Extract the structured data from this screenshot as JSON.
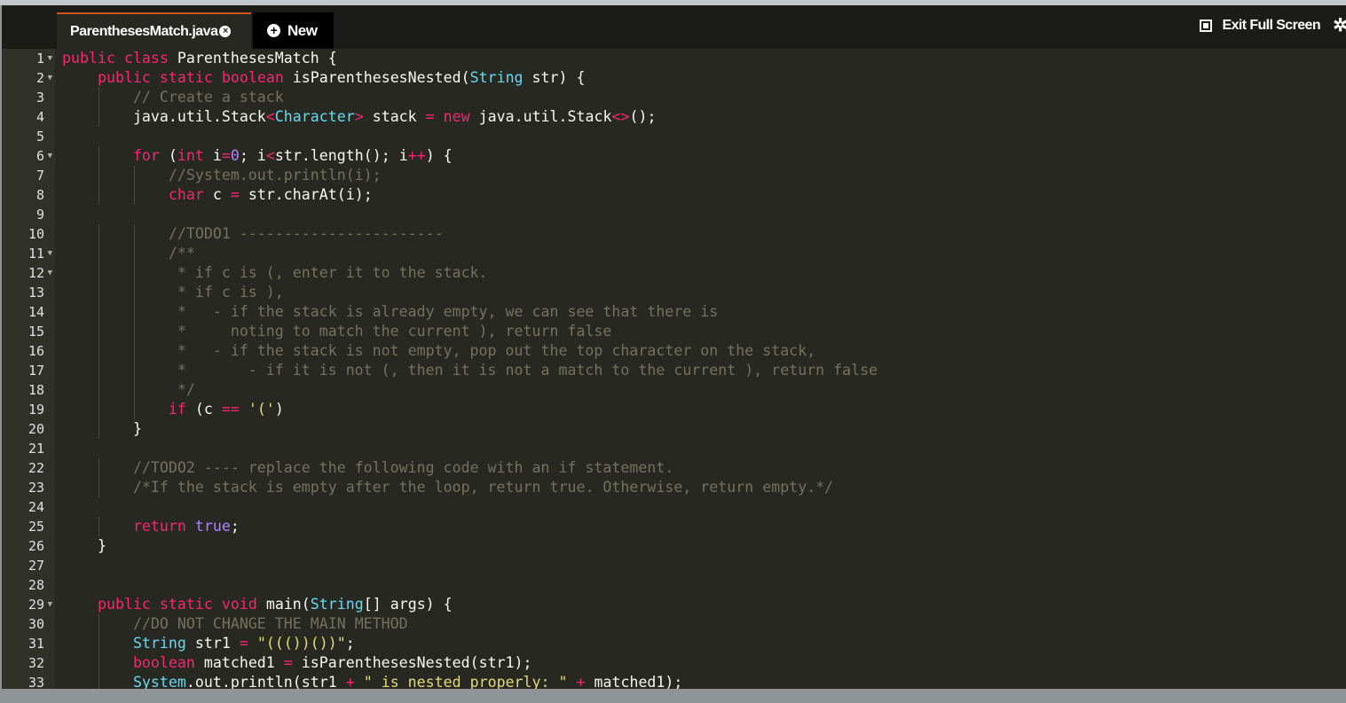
{
  "tabs": {
    "active_label": "ParenthesesMatch.java",
    "new_label": "New"
  },
  "toolbar": {
    "fullscreen_label": "Exit Full Screen"
  },
  "icons": {
    "tab_close": "close-icon",
    "new": "plus-circle-icon",
    "fullscreen": "exit-fullscreen-icon",
    "settings": "gear-icon"
  },
  "colors": {
    "editor_bg": "#272822",
    "gutter_bg": "#2f3129",
    "keyword": "#f92672",
    "type": "#66d9ef",
    "comment": "#75715e",
    "number": "#ae81ff",
    "string": "#e6db74",
    "tab_accent": "#d0541b"
  },
  "editor": {
    "lines": [
      {
        "n": "1",
        "fold": true,
        "indent": 0,
        "tokens": [
          [
            "kw",
            "public"
          ],
          [
            "pl",
            " "
          ],
          [
            "kw",
            "class"
          ],
          [
            "pl",
            " ParenthesesMatch {"
          ]
        ]
      },
      {
        "n": "2",
        "fold": true,
        "indent": 1,
        "tokens": [
          [
            "kw",
            "public"
          ],
          [
            "pl",
            " "
          ],
          [
            "kw",
            "static"
          ],
          [
            "pl",
            " "
          ],
          [
            "kw",
            "boolean"
          ],
          [
            "pl",
            " isParenthesesNested("
          ],
          [
            "ty",
            "String"
          ],
          [
            "pl",
            " str) {"
          ]
        ]
      },
      {
        "n": "3",
        "fold": false,
        "indent": 2,
        "tokens": [
          [
            "cm",
            "// Create a stack"
          ]
        ]
      },
      {
        "n": "4",
        "fold": false,
        "indent": 2,
        "tokens": [
          [
            "pl",
            "java.util.Stack"
          ],
          [
            "op",
            "<"
          ],
          [
            "ty",
            "Character"
          ],
          [
            "op",
            ">"
          ],
          [
            "pl",
            " stack "
          ],
          [
            "op",
            "="
          ],
          [
            "pl",
            " "
          ],
          [
            "kw",
            "new"
          ],
          [
            "pl",
            " java.util.Stack"
          ],
          [
            "op",
            "<>"
          ],
          [
            "pl",
            "();"
          ]
        ]
      },
      {
        "n": "5",
        "fold": false,
        "indent": 0,
        "tokens": []
      },
      {
        "n": "6",
        "fold": true,
        "indent": 2,
        "tokens": [
          [
            "kw",
            "for"
          ],
          [
            "pl",
            " ("
          ],
          [
            "kw",
            "int"
          ],
          [
            "pl",
            " i"
          ],
          [
            "op",
            "="
          ],
          [
            "nu",
            "0"
          ],
          [
            "pl",
            "; i"
          ],
          [
            "op",
            "<"
          ],
          [
            "pl",
            "str.length(); i"
          ],
          [
            "op",
            "++"
          ],
          [
            "pl",
            ") {"
          ]
        ]
      },
      {
        "n": "7",
        "fold": false,
        "indent": 3,
        "tokens": [
          [
            "cm",
            "//System.out.println(i);"
          ]
        ]
      },
      {
        "n": "8",
        "fold": false,
        "indent": 3,
        "tokens": [
          [
            "kw",
            "char"
          ],
          [
            "pl",
            " c "
          ],
          [
            "op",
            "="
          ],
          [
            "pl",
            " str.charAt(i);"
          ]
        ]
      },
      {
        "n": "9",
        "fold": false,
        "indent": 0,
        "tokens": []
      },
      {
        "n": "10",
        "fold": false,
        "indent": 3,
        "tokens": [
          [
            "cm",
            "//TODO1 -----------------------"
          ]
        ]
      },
      {
        "n": "11",
        "fold": true,
        "indent": 3,
        "tokens": [
          [
            "cm",
            "/**"
          ]
        ]
      },
      {
        "n": "12",
        "fold": true,
        "indent": 3,
        "tokens": [
          [
            "cm",
            " * if c is (, enter it to the stack."
          ]
        ]
      },
      {
        "n": "13",
        "fold": false,
        "indent": 3,
        "tokens": [
          [
            "cm",
            " * if c is ),"
          ]
        ]
      },
      {
        "n": "14",
        "fold": false,
        "indent": 3,
        "tokens": [
          [
            "cm",
            " *   - if the stack is already empty, we can see that there is"
          ]
        ]
      },
      {
        "n": "15",
        "fold": false,
        "indent": 3,
        "tokens": [
          [
            "cm",
            " *     noting to match the current ), return false"
          ]
        ]
      },
      {
        "n": "16",
        "fold": false,
        "indent": 3,
        "tokens": [
          [
            "cm",
            " *   - if the stack is not empty, pop out the top character on the stack,"
          ]
        ]
      },
      {
        "n": "17",
        "fold": false,
        "indent": 3,
        "tokens": [
          [
            "cm",
            " *       - if it is not (, then it is not a match to the current ), return false"
          ]
        ]
      },
      {
        "n": "18",
        "fold": false,
        "indent": 3,
        "tokens": [
          [
            "cm",
            " */"
          ]
        ]
      },
      {
        "n": "19",
        "fold": false,
        "indent": 3,
        "tokens": [
          [
            "kw",
            "if"
          ],
          [
            "pl",
            " (c "
          ],
          [
            "op",
            "=="
          ],
          [
            "pl",
            " "
          ],
          [
            "st",
            "'('"
          ],
          [
            "pl",
            ")"
          ]
        ]
      },
      {
        "n": "20",
        "fold": false,
        "indent": 2,
        "tokens": [
          [
            "pl",
            "}"
          ]
        ]
      },
      {
        "n": "21",
        "fold": false,
        "indent": 0,
        "tokens": []
      },
      {
        "n": "22",
        "fold": false,
        "indent": 2,
        "tokens": [
          [
            "cm",
            "//TODO2 ---- replace the following code with an if statement."
          ]
        ]
      },
      {
        "n": "23",
        "fold": false,
        "indent": 2,
        "tokens": [
          [
            "cm",
            "/*If the stack is empty after the loop, return true. Otherwise, return empty.*/"
          ]
        ]
      },
      {
        "n": "24",
        "fold": false,
        "indent": 0,
        "tokens": []
      },
      {
        "n": "25",
        "fold": false,
        "indent": 2,
        "tokens": [
          [
            "kw",
            "return"
          ],
          [
            "pl",
            " "
          ],
          [
            "nu",
            "true"
          ],
          [
            "pl",
            ";"
          ]
        ]
      },
      {
        "n": "26",
        "fold": false,
        "indent": 1,
        "tokens": [
          [
            "pl",
            "}"
          ]
        ]
      },
      {
        "n": "27",
        "fold": false,
        "indent": 0,
        "tokens": []
      },
      {
        "n": "28",
        "fold": false,
        "indent": 0,
        "tokens": []
      },
      {
        "n": "29",
        "fold": true,
        "indent": 1,
        "tokens": [
          [
            "kw",
            "public"
          ],
          [
            "pl",
            " "
          ],
          [
            "kw",
            "static"
          ],
          [
            "pl",
            " "
          ],
          [
            "kw",
            "void"
          ],
          [
            "pl",
            " main("
          ],
          [
            "ty",
            "String"
          ],
          [
            "pl",
            "[] args) {"
          ]
        ]
      },
      {
        "n": "30",
        "fold": false,
        "indent": 2,
        "tokens": [
          [
            "cm",
            "//DO NOT CHANGE THE MAIN METHOD"
          ]
        ]
      },
      {
        "n": "31",
        "fold": false,
        "indent": 2,
        "tokens": [
          [
            "ty",
            "String"
          ],
          [
            "pl",
            " str1 "
          ],
          [
            "op",
            "="
          ],
          [
            "pl",
            " "
          ],
          [
            "st",
            "\"((())())\""
          ],
          [
            "pl",
            ";"
          ]
        ]
      },
      {
        "n": "32",
        "fold": false,
        "indent": 2,
        "tokens": [
          [
            "kw",
            "boolean"
          ],
          [
            "pl",
            " matched1 "
          ],
          [
            "op",
            "="
          ],
          [
            "pl",
            " isParenthesesNested(str1);"
          ]
        ]
      },
      {
        "n": "33",
        "fold": false,
        "indent": 2,
        "tokens": [
          [
            "ty",
            "System"
          ],
          [
            "pl",
            ".out.println(str1 "
          ],
          [
            "op",
            "+"
          ],
          [
            "pl",
            " "
          ],
          [
            "st",
            "\" is nested properly: \""
          ],
          [
            "pl",
            " "
          ],
          [
            "op",
            "+"
          ],
          [
            "pl",
            " matched1);"
          ]
        ]
      }
    ]
  }
}
